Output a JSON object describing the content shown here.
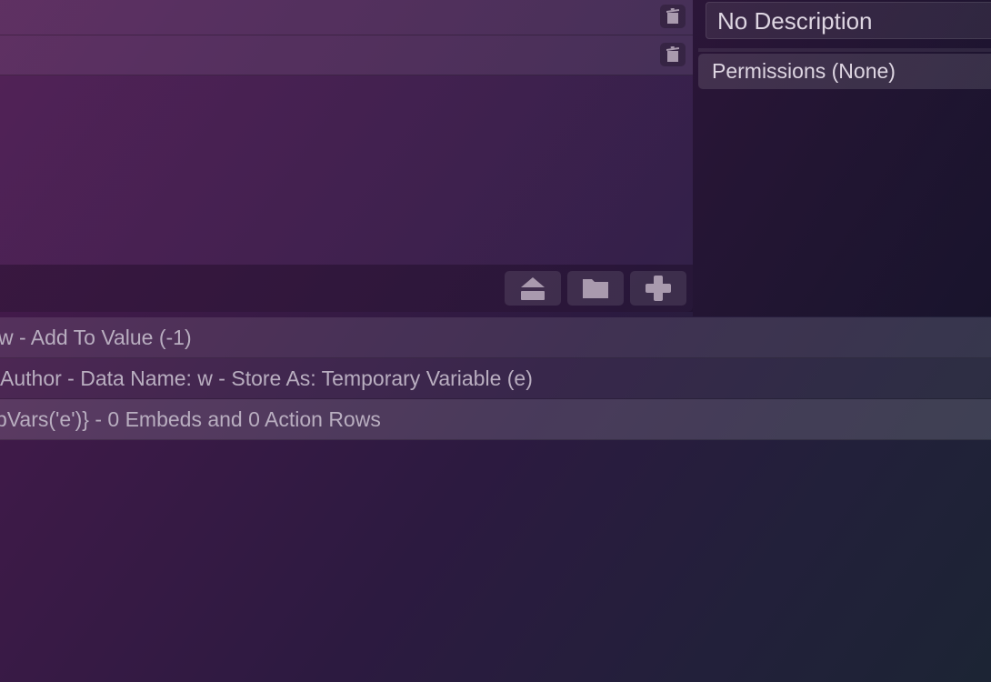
{
  "command_list": {
    "rows": [
      {
        "delete_icon": "trash-icon"
      },
      {
        "delete_icon": "trash-icon"
      }
    ]
  },
  "toolbar": {
    "buttons": [
      {
        "icon": "eject-icon"
      },
      {
        "icon": "folder-icon"
      },
      {
        "icon": "plus-icon"
      }
    ]
  },
  "details": {
    "description": "No Description",
    "permissions": "Permissions (None)"
  },
  "actions": [
    {
      "text": "w - Add To Value (-1)"
    },
    {
      "text": " Author - Data Name: w - Store As: Temporary Variable (e)"
    },
    {
      "text": "pVars('e')} - 0 Embeds and 0 Action Rows"
    }
  ],
  "colors": {
    "icon": "#a99aae",
    "text_primary": "#ded6e2",
    "text_secondary": "#b9aec0"
  }
}
